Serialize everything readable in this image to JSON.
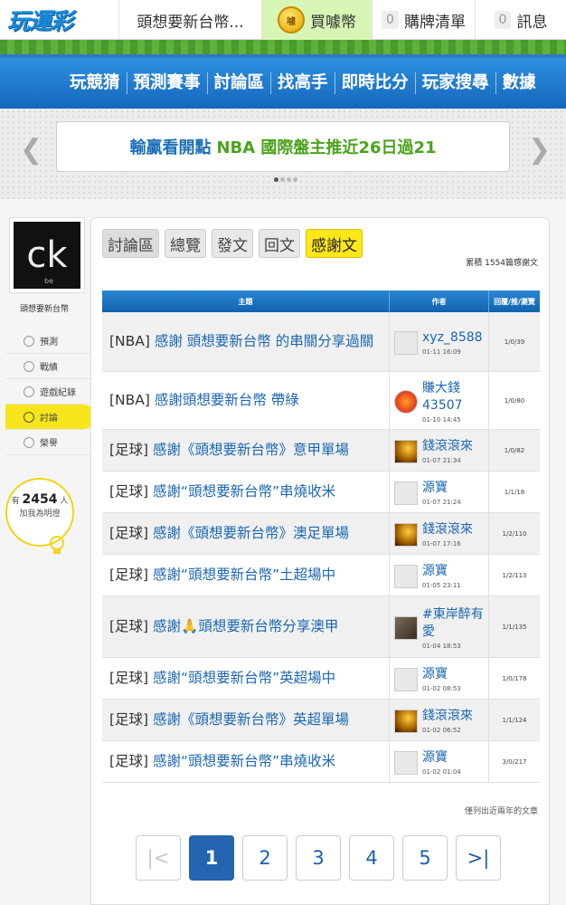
{
  "header": {
    "logo_text": "玩運彩",
    "user_name": "頭想要新台幣...",
    "buy_label": "買噱幣",
    "coin_icon": "噱",
    "cart_count": "0",
    "cart_label": "購牌清單",
    "msg_count": "0",
    "msg_label": "訊息"
  },
  "nav": [
    "玩競猜",
    "預測賽事",
    "討論區",
    "找高手",
    "即時比分",
    "玩家搜尋",
    "數據"
  ],
  "banner": {
    "text_main": "輸贏看開點",
    "text_highlight": "NBA 國際盤主推近26日過21"
  },
  "sidebar": {
    "avatar_text": "ck",
    "avatar_sub": "be",
    "user_name": "頭想要新台幣",
    "menu": [
      "預測",
      "戰績",
      "遊戲紀錄",
      "討論",
      "榮譽"
    ],
    "fans_prefix": "有",
    "fans_count": "2454",
    "fans_suffix": "人",
    "fans_caption": "加我為明燈"
  },
  "main": {
    "tabs": [
      "討論區",
      "總覽",
      "發文",
      "回文",
      "感謝文"
    ],
    "count_text": "累積 1554篇感謝文",
    "columns": [
      "主題",
      "作者",
      "回覆/推/瀏覽"
    ],
    "rows": [
      {
        "tag": "[NBA]",
        "title": "感謝 頭想要新台幣 的串關分享過關",
        "author": "xyz_8588",
        "date": "01-11 16:09",
        "stats": "1/0/39"
      },
      {
        "tag": "[NBA]",
        "title": "感謝頭想要新台幣 帶綠",
        "author": "賺大錢43507",
        "date": "01-10 14:45",
        "stats": "1/0/80"
      },
      {
        "tag": "[足球]",
        "title": "感謝《頭想要新台幣》意甲單場",
        "author": "錢滾滾來",
        "date": "01-07 21:34",
        "stats": "1/0/82"
      },
      {
        "tag": "[足球]",
        "title": "感謝“頭想要新台幣”串燒收米",
        "author": "源寶",
        "date": "01-07 21:24",
        "stats": "1/1/18"
      },
      {
        "tag": "[足球]",
        "title": "感謝《頭想要新台幣》澳足單場",
        "author": "錢滾滾來",
        "date": "01-07 17:16",
        "stats": "1/2/110"
      },
      {
        "tag": "[足球]",
        "title": "感謝“頭想要新台幣”土超場中",
        "author": "源寶",
        "date": "01-05 23:11",
        "stats": "1/2/113"
      },
      {
        "tag": "[足球]",
        "title": "感謝🙏頭想要新台幣分享澳甲",
        "author": "#東岸醉有愛",
        "date": "01-04 18:53",
        "stats": "1/1/135"
      },
      {
        "tag": "[足球]",
        "title": "感謝“頭想要新台幣”英超場中",
        "author": "源寶",
        "date": "01-02 08:53",
        "stats": "1/0/178"
      },
      {
        "tag": "[足球]",
        "title": "感謝《頭想要新台幣》英超單場",
        "author": "錢滾滾來",
        "date": "01-02 06:52",
        "stats": "1/1/124"
      },
      {
        "tag": "[足球]",
        "title": "感謝“頭想要新台幣”串燒收米",
        "author": "源寶",
        "date": "01-02 01:04",
        "stats": "3/0/217"
      }
    ],
    "note": "僅列出近兩年的文章",
    "pages": [
      "1",
      "2",
      "3",
      "4",
      "5"
    ],
    "first_icon": "|<",
    "last_icon": ">|"
  }
}
